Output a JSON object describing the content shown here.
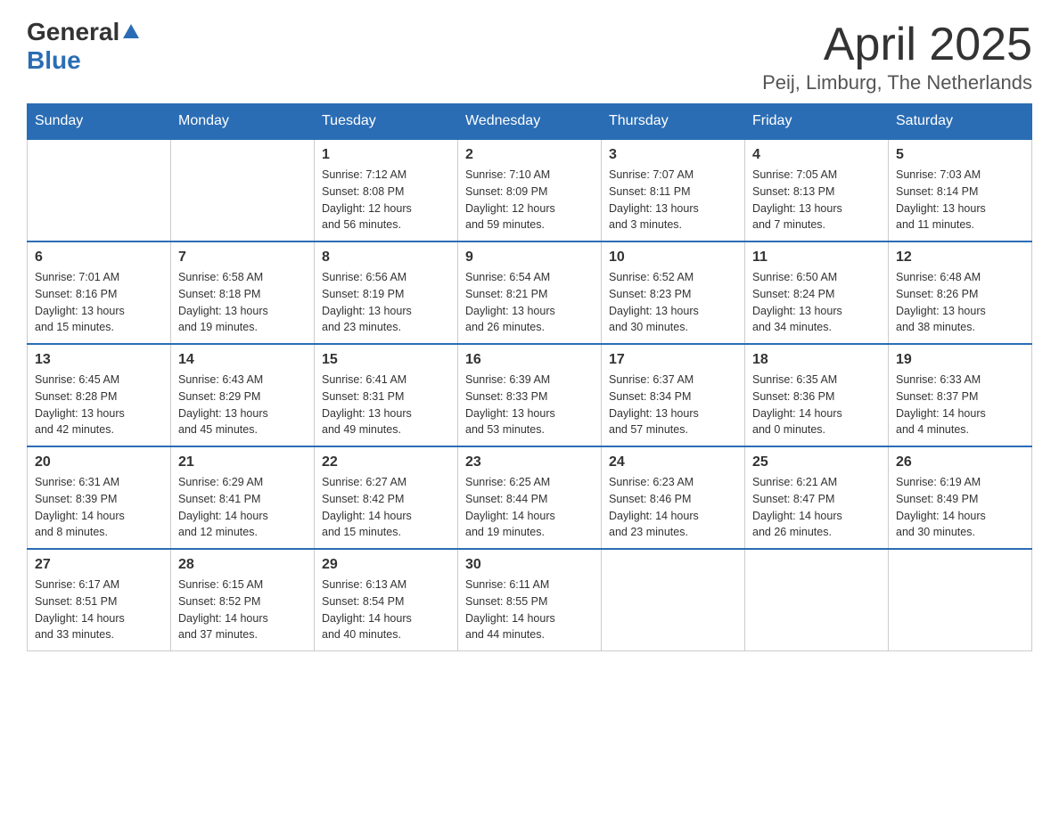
{
  "header": {
    "logo_general": "General",
    "logo_blue": "Blue",
    "title": "April 2025",
    "subtitle": "Peij, Limburg, The Netherlands"
  },
  "calendar": {
    "days_of_week": [
      "Sunday",
      "Monday",
      "Tuesday",
      "Wednesday",
      "Thursday",
      "Friday",
      "Saturday"
    ],
    "weeks": [
      [
        {
          "day": "",
          "info": ""
        },
        {
          "day": "",
          "info": ""
        },
        {
          "day": "1",
          "info": "Sunrise: 7:12 AM\nSunset: 8:08 PM\nDaylight: 12 hours\nand 56 minutes."
        },
        {
          "day": "2",
          "info": "Sunrise: 7:10 AM\nSunset: 8:09 PM\nDaylight: 12 hours\nand 59 minutes."
        },
        {
          "day": "3",
          "info": "Sunrise: 7:07 AM\nSunset: 8:11 PM\nDaylight: 13 hours\nand 3 minutes."
        },
        {
          "day": "4",
          "info": "Sunrise: 7:05 AM\nSunset: 8:13 PM\nDaylight: 13 hours\nand 7 minutes."
        },
        {
          "day": "5",
          "info": "Sunrise: 7:03 AM\nSunset: 8:14 PM\nDaylight: 13 hours\nand 11 minutes."
        }
      ],
      [
        {
          "day": "6",
          "info": "Sunrise: 7:01 AM\nSunset: 8:16 PM\nDaylight: 13 hours\nand 15 minutes."
        },
        {
          "day": "7",
          "info": "Sunrise: 6:58 AM\nSunset: 8:18 PM\nDaylight: 13 hours\nand 19 minutes."
        },
        {
          "day": "8",
          "info": "Sunrise: 6:56 AM\nSunset: 8:19 PM\nDaylight: 13 hours\nand 23 minutes."
        },
        {
          "day": "9",
          "info": "Sunrise: 6:54 AM\nSunset: 8:21 PM\nDaylight: 13 hours\nand 26 minutes."
        },
        {
          "day": "10",
          "info": "Sunrise: 6:52 AM\nSunset: 8:23 PM\nDaylight: 13 hours\nand 30 minutes."
        },
        {
          "day": "11",
          "info": "Sunrise: 6:50 AM\nSunset: 8:24 PM\nDaylight: 13 hours\nand 34 minutes."
        },
        {
          "day": "12",
          "info": "Sunrise: 6:48 AM\nSunset: 8:26 PM\nDaylight: 13 hours\nand 38 minutes."
        }
      ],
      [
        {
          "day": "13",
          "info": "Sunrise: 6:45 AM\nSunset: 8:28 PM\nDaylight: 13 hours\nand 42 minutes."
        },
        {
          "day": "14",
          "info": "Sunrise: 6:43 AM\nSunset: 8:29 PM\nDaylight: 13 hours\nand 45 minutes."
        },
        {
          "day": "15",
          "info": "Sunrise: 6:41 AM\nSunset: 8:31 PM\nDaylight: 13 hours\nand 49 minutes."
        },
        {
          "day": "16",
          "info": "Sunrise: 6:39 AM\nSunset: 8:33 PM\nDaylight: 13 hours\nand 53 minutes."
        },
        {
          "day": "17",
          "info": "Sunrise: 6:37 AM\nSunset: 8:34 PM\nDaylight: 13 hours\nand 57 minutes."
        },
        {
          "day": "18",
          "info": "Sunrise: 6:35 AM\nSunset: 8:36 PM\nDaylight: 14 hours\nand 0 minutes."
        },
        {
          "day": "19",
          "info": "Sunrise: 6:33 AM\nSunset: 8:37 PM\nDaylight: 14 hours\nand 4 minutes."
        }
      ],
      [
        {
          "day": "20",
          "info": "Sunrise: 6:31 AM\nSunset: 8:39 PM\nDaylight: 14 hours\nand 8 minutes."
        },
        {
          "day": "21",
          "info": "Sunrise: 6:29 AM\nSunset: 8:41 PM\nDaylight: 14 hours\nand 12 minutes."
        },
        {
          "day": "22",
          "info": "Sunrise: 6:27 AM\nSunset: 8:42 PM\nDaylight: 14 hours\nand 15 minutes."
        },
        {
          "day": "23",
          "info": "Sunrise: 6:25 AM\nSunset: 8:44 PM\nDaylight: 14 hours\nand 19 minutes."
        },
        {
          "day": "24",
          "info": "Sunrise: 6:23 AM\nSunset: 8:46 PM\nDaylight: 14 hours\nand 23 minutes."
        },
        {
          "day": "25",
          "info": "Sunrise: 6:21 AM\nSunset: 8:47 PM\nDaylight: 14 hours\nand 26 minutes."
        },
        {
          "day": "26",
          "info": "Sunrise: 6:19 AM\nSunset: 8:49 PM\nDaylight: 14 hours\nand 30 minutes."
        }
      ],
      [
        {
          "day": "27",
          "info": "Sunrise: 6:17 AM\nSunset: 8:51 PM\nDaylight: 14 hours\nand 33 minutes."
        },
        {
          "day": "28",
          "info": "Sunrise: 6:15 AM\nSunset: 8:52 PM\nDaylight: 14 hours\nand 37 minutes."
        },
        {
          "day": "29",
          "info": "Sunrise: 6:13 AM\nSunset: 8:54 PM\nDaylight: 14 hours\nand 40 minutes."
        },
        {
          "day": "30",
          "info": "Sunrise: 6:11 AM\nSunset: 8:55 PM\nDaylight: 14 hours\nand 44 minutes."
        },
        {
          "day": "",
          "info": ""
        },
        {
          "day": "",
          "info": ""
        },
        {
          "day": "",
          "info": ""
        }
      ]
    ]
  }
}
